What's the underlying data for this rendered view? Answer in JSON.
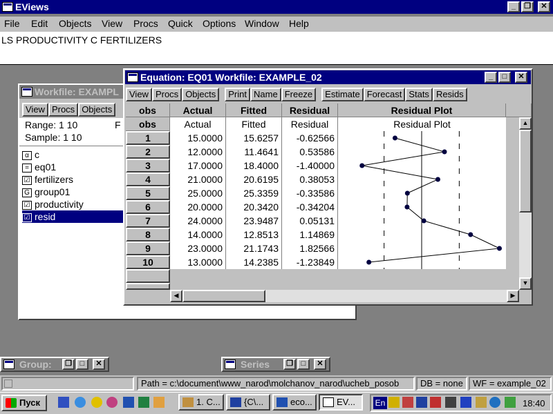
{
  "app": {
    "title": "EViews"
  },
  "menubar": [
    "File",
    "Edit",
    "Objects",
    "View",
    "Procs",
    "Quick",
    "Options",
    "Window",
    "Help"
  ],
  "command": "LS PRODUCTIVITY C  FERTILIZERS",
  "workfile": {
    "title": "Workfile: EXAMPL",
    "toolbar": [
      "View",
      "Procs",
      "Objects"
    ],
    "range_label": "Range:",
    "range_value": "1 10",
    "range_extra": "F",
    "sample_label": "Sample:",
    "sample_value": "1 10",
    "objects": [
      {
        "icon": "alpha",
        "name": "c"
      },
      {
        "icon": "equals",
        "name": "eq01"
      },
      {
        "icon": "check",
        "name": "fertilizers"
      },
      {
        "icon": "G",
        "name": "group01"
      },
      {
        "icon": "check",
        "name": "productivity"
      },
      {
        "icon": "check",
        "name": "resid"
      }
    ]
  },
  "equation": {
    "title": "Equation: EQ01   Workfile: EXAMPLE_02",
    "toolbar": [
      "View",
      "Procs",
      "Objects",
      "Print",
      "Name",
      "Freeze",
      "Estimate",
      "Forecast",
      "Stats",
      "Resids"
    ],
    "headers": [
      "obs",
      "Actual",
      "Fitted",
      "Residual",
      "Residual Plot"
    ],
    "subheaders": [
      "obs",
      "Actual",
      "Fitted",
      "Residual",
      "Residual Plot"
    ],
    "rows": [
      {
        "obs": "1",
        "actual": "15.0000",
        "fitted": "15.6257",
        "residual": "-0.62566"
      },
      {
        "obs": "2",
        "actual": "12.0000",
        "fitted": "11.4641",
        "residual": "0.53586"
      },
      {
        "obs": "3",
        "actual": "17.0000",
        "fitted": "18.4000",
        "residual": "-1.40000"
      },
      {
        "obs": "4",
        "actual": "21.0000",
        "fitted": "20.6195",
        "residual": "0.38053"
      },
      {
        "obs": "5",
        "actual": "25.0000",
        "fitted": "25.3359",
        "residual": "-0.33586"
      },
      {
        "obs": "6",
        "actual": "20.0000",
        "fitted": "20.3420",
        "residual": "-0.34204"
      },
      {
        "obs": "7",
        "actual": "24.0000",
        "fitted": "23.9487",
        "residual": "0.05131"
      },
      {
        "obs": "8",
        "actual": "14.0000",
        "fitted": "12.8513",
        "residual": "1.14869"
      },
      {
        "obs": "9",
        "actual": "23.0000",
        "fitted": "21.1743",
        "residual": "1.82566"
      },
      {
        "obs": "10",
        "actual": "13.0000",
        "fitted": "14.2385",
        "residual": "-1.23849"
      }
    ],
    "residual_values": [
      -0.62566,
      0.53586,
      -1.4,
      0.38053,
      -0.33586,
      -0.34204,
      0.05131,
      1.14869,
      1.82566,
      -1.23849
    ],
    "plot_scale": {
      "zero": 0,
      "band": 0.8825,
      "range": 1.85
    }
  },
  "minimized": [
    {
      "title": "Group:"
    },
    {
      "title": "Series"
    }
  ],
  "statusbar": {
    "path": "Path = c:\\document\\www_narod\\molchanov_narod\\ucheb_posob",
    "db": "DB = none",
    "wf": "WF = example_02"
  },
  "taskbar": {
    "start": "Пуск",
    "tasks": [
      "1. C...",
      "{C\\...",
      "eco...",
      "EV..."
    ],
    "lang": "En",
    "clock": "18:40"
  },
  "colors": {
    "title_active": "#000080",
    "title_inactive": "#808080",
    "desktop": "#808080",
    "plot_line": "#000000",
    "plot_point": "#000040"
  }
}
